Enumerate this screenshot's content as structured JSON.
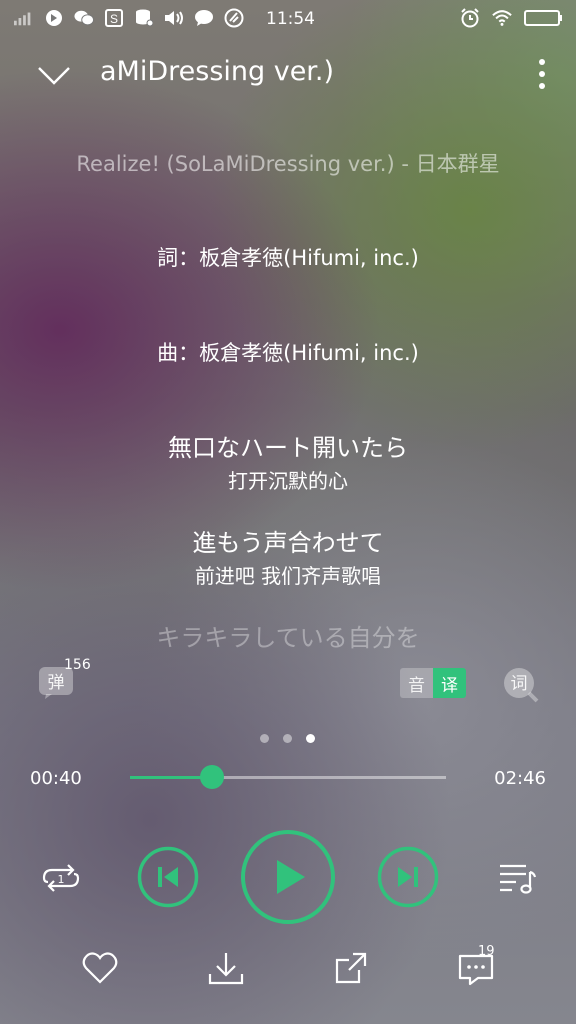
{
  "status_bar": {
    "time": "11:54",
    "left_icons": [
      "signal-icon",
      "app-icon",
      "wechat-icon",
      "s-app-icon",
      "storage-icon",
      "volume-icon",
      "chat-icon",
      "clean-icon"
    ],
    "right_icons": [
      "alarm-icon",
      "wifi-icon",
      "battery-icon"
    ]
  },
  "header": {
    "title": "aMiDressing ver.)"
  },
  "lyrics": {
    "subtitle": "Realize! (SoLaMiDressing ver.) - 日本群星",
    "lyricist": "詞：板倉孝徳(Hifumi, inc.)",
    "composer": "曲：板倉孝徳(Hifumi, inc.)",
    "lines": [
      {
        "text": "無口なハート開いたら",
        "translation": "打开沉默的心"
      },
      {
        "text": "進もう声合わせて",
        "translation": "前进吧 我们齐声歌唱"
      }
    ],
    "next_line": "キラキラしている自分を"
  },
  "controls_row": {
    "danmu_label": "弹",
    "danmu_count": "156",
    "yin_label": "音",
    "yi_label": "译",
    "ci_label": "词"
  },
  "pager": {
    "count": 3,
    "active": 2
  },
  "progress": {
    "current": "00:40",
    "total": "02:46",
    "fraction": 0.258
  },
  "comments": {
    "count": "19"
  },
  "colors": {
    "accent": "#31c27c"
  }
}
